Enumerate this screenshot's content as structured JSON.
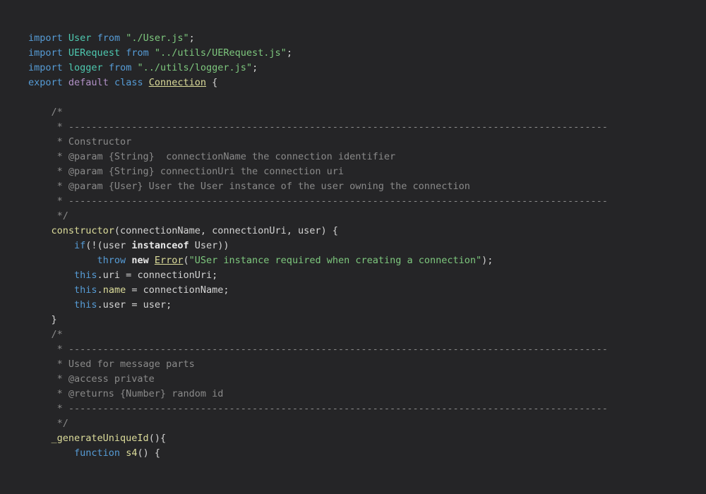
{
  "editor": {
    "language": "javascript",
    "file_name": "Connection.js",
    "theme_name": "dark",
    "colors": {
      "background": "#252527",
      "foreground": "#d4d4d4",
      "keyword": "#569cd6",
      "keyword_modifier": "#b392c8",
      "operator_keyword": "#e8e8e8",
      "type": "#4ec9b0",
      "string": "#7ec87e",
      "class_name": "#dcdc9a",
      "function_name": "#dcdc9a",
      "property": "#dcdc9a",
      "comment": "#8a8a8a"
    },
    "lines": [
      {
        "id": 1,
        "text": "import User from \"./User.js\";",
        "tokens": [
          {
            "t": "import",
            "c": "kw"
          },
          {
            "t": " ",
            "c": "plain"
          },
          {
            "t": "User",
            "c": "type"
          },
          {
            "t": " ",
            "c": "plain"
          },
          {
            "t": "from",
            "c": "kw"
          },
          {
            "t": " ",
            "c": "plain"
          },
          {
            "t": "\"./User.js\"",
            "c": "str"
          },
          {
            "t": ";",
            "c": "punct"
          }
        ]
      },
      {
        "id": 2,
        "text": "import UERequest from \"../utils/UERequest.js\";",
        "tokens": [
          {
            "t": "import",
            "c": "kw"
          },
          {
            "t": " ",
            "c": "plain"
          },
          {
            "t": "UERequest",
            "c": "type"
          },
          {
            "t": " ",
            "c": "plain"
          },
          {
            "t": "from",
            "c": "kw"
          },
          {
            "t": " ",
            "c": "plain"
          },
          {
            "t": "\"../utils/UERequest.js\"",
            "c": "str"
          },
          {
            "t": ";",
            "c": "punct"
          }
        ]
      },
      {
        "id": 3,
        "text": "import logger from \"../utils/logger.js\";",
        "tokens": [
          {
            "t": "import",
            "c": "kw"
          },
          {
            "t": " ",
            "c": "plain"
          },
          {
            "t": "logger",
            "c": "type"
          },
          {
            "t": " ",
            "c": "plain"
          },
          {
            "t": "from",
            "c": "kw"
          },
          {
            "t": " ",
            "c": "plain"
          },
          {
            "t": "\"../utils/logger.js\"",
            "c": "str"
          },
          {
            "t": ";",
            "c": "punct"
          }
        ]
      },
      {
        "id": 4,
        "text": "export default class Connection {",
        "tokens": [
          {
            "t": "export",
            "c": "kw"
          },
          {
            "t": " ",
            "c": "plain"
          },
          {
            "t": "default",
            "c": "kw2"
          },
          {
            "t": " ",
            "c": "plain"
          },
          {
            "t": "class",
            "c": "kw"
          },
          {
            "t": " ",
            "c": "plain"
          },
          {
            "t": "Connection",
            "c": "cls"
          },
          {
            "t": " {",
            "c": "punct"
          }
        ]
      },
      {
        "id": 5,
        "text": "",
        "tokens": []
      },
      {
        "id": 6,
        "text": "    /*",
        "tokens": [
          {
            "t": "    /*",
            "c": "com"
          }
        ]
      },
      {
        "id": 7,
        "text": "     * ----------------------------------------------------------------------------------------------",
        "tokens": [
          {
            "t": "     * ----------------------------------------------------------------------------------------------",
            "c": "com"
          }
        ]
      },
      {
        "id": 8,
        "text": "     * Constructor",
        "tokens": [
          {
            "t": "     * Constructor",
            "c": "com"
          }
        ]
      },
      {
        "id": 9,
        "text": "     * @param {String}  connectionName the connection identifier",
        "tokens": [
          {
            "t": "     * @param {String}  connectionName the connection identifier",
            "c": "com"
          }
        ]
      },
      {
        "id": 10,
        "text": "     * @param {String} connectionUri the connection uri",
        "tokens": [
          {
            "t": "     * @param {String} connectionUri the connection uri",
            "c": "com"
          }
        ]
      },
      {
        "id": 11,
        "text": "     * @param {User} User the User instance of the user owning the connection",
        "tokens": [
          {
            "t": "     * @param {User} User the User instance of the user owning the connection",
            "c": "com"
          }
        ]
      },
      {
        "id": 12,
        "text": "     * ----------------------------------------------------------------------------------------------",
        "tokens": [
          {
            "t": "     * ----------------------------------------------------------------------------------------------",
            "c": "com"
          }
        ]
      },
      {
        "id": 13,
        "text": "     */",
        "tokens": [
          {
            "t": "     */",
            "c": "com"
          }
        ]
      },
      {
        "id": 14,
        "text": "    constructor(connectionName, connectionUri, user) {",
        "tokens": [
          {
            "t": "    ",
            "c": "plain"
          },
          {
            "t": "constructor",
            "c": "fn"
          },
          {
            "t": "(connectionName, connectionUri, user) {",
            "c": "plain"
          }
        ]
      },
      {
        "id": 15,
        "text": "        if(!(user instanceof User))",
        "tokens": [
          {
            "t": "        ",
            "c": "plain"
          },
          {
            "t": "if",
            "c": "kw"
          },
          {
            "t": "(!(user ",
            "c": "plain"
          },
          {
            "t": "instanceof",
            "c": "kwop"
          },
          {
            "t": " User))",
            "c": "plain"
          }
        ]
      },
      {
        "id": 16,
        "text": "            throw new Error(\"USer instance required when creating a connection\");",
        "tokens": [
          {
            "t": "            ",
            "c": "plain"
          },
          {
            "t": "throw",
            "c": "kw"
          },
          {
            "t": " ",
            "c": "plain"
          },
          {
            "t": "new",
            "c": "kwop"
          },
          {
            "t": " ",
            "c": "plain"
          },
          {
            "t": "Error",
            "c": "cls"
          },
          {
            "t": "(",
            "c": "plain"
          },
          {
            "t": "\"USer instance required when creating a connection\"",
            "c": "str"
          },
          {
            "t": ");",
            "c": "plain"
          }
        ]
      },
      {
        "id": 17,
        "text": "        this.uri = connectionUri;",
        "tokens": [
          {
            "t": "        ",
            "c": "plain"
          },
          {
            "t": "this",
            "c": "kw"
          },
          {
            "t": ".uri = connectionUri;",
            "c": "plain"
          }
        ]
      },
      {
        "id": 18,
        "text": "        this.name = connectionName;",
        "tokens": [
          {
            "t": "        ",
            "c": "plain"
          },
          {
            "t": "this",
            "c": "kw"
          },
          {
            "t": ".",
            "c": "plain"
          },
          {
            "t": "name",
            "c": "prop"
          },
          {
            "t": " = connectionName;",
            "c": "plain"
          }
        ]
      },
      {
        "id": 19,
        "text": "        this.user = user;",
        "tokens": [
          {
            "t": "        ",
            "c": "plain"
          },
          {
            "t": "this",
            "c": "kw"
          },
          {
            "t": ".user = user;",
            "c": "plain"
          }
        ]
      },
      {
        "id": 20,
        "text": "    }",
        "tokens": [
          {
            "t": "    }",
            "c": "plain"
          }
        ]
      },
      {
        "id": 21,
        "text": "    /*",
        "tokens": [
          {
            "t": "    /*",
            "c": "com"
          }
        ]
      },
      {
        "id": 22,
        "text": "     * ----------------------------------------------------------------------------------------------",
        "tokens": [
          {
            "t": "     * ----------------------------------------------------------------------------------------------",
            "c": "com"
          }
        ]
      },
      {
        "id": 23,
        "text": "     * Used for message parts",
        "tokens": [
          {
            "t": "     * Used for message parts",
            "c": "com"
          }
        ]
      },
      {
        "id": 24,
        "text": "     * @access private",
        "tokens": [
          {
            "t": "     * @access private",
            "c": "com"
          }
        ]
      },
      {
        "id": 25,
        "text": "     * @returns {Number} random id",
        "tokens": [
          {
            "t": "     * @returns {Number} random id",
            "c": "com"
          }
        ]
      },
      {
        "id": 26,
        "text": "     * ----------------------------------------------------------------------------------------------",
        "tokens": [
          {
            "t": "     * ----------------------------------------------------------------------------------------------",
            "c": "com"
          }
        ]
      },
      {
        "id": 27,
        "text": "     */",
        "tokens": [
          {
            "t": "     */",
            "c": "com"
          }
        ]
      },
      {
        "id": 28,
        "text": "    _generateUniqueId(){",
        "tokens": [
          {
            "t": "    ",
            "c": "plain"
          },
          {
            "t": "_generateUniqueId",
            "c": "fn"
          },
          {
            "t": "(){",
            "c": "plain"
          }
        ]
      },
      {
        "id": 29,
        "text": "        function s4() {",
        "tokens": [
          {
            "t": "        ",
            "c": "plain"
          },
          {
            "t": "function",
            "c": "kw"
          },
          {
            "t": " ",
            "c": "plain"
          },
          {
            "t": "s4",
            "c": "fn"
          },
          {
            "t": "() {",
            "c": "plain"
          }
        ]
      }
    ]
  }
}
